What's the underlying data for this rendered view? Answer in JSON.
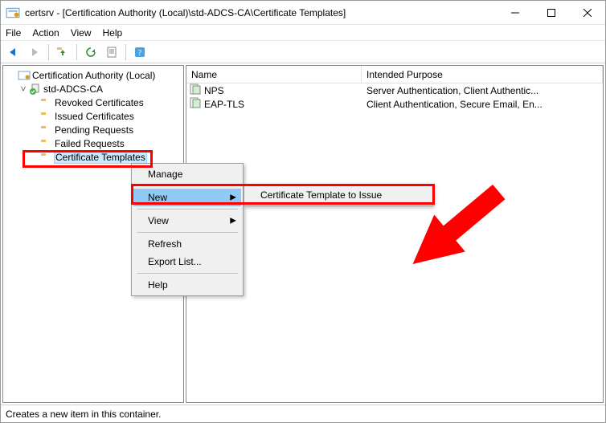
{
  "window": {
    "title": "certsrv - [Certification Authority (Local)\\std-ADCS-CA\\Certificate Templates]"
  },
  "menubar": [
    "File",
    "Action",
    "View",
    "Help"
  ],
  "tree": {
    "root": "Certification Authority (Local)",
    "ca": "std-ADCS-CA",
    "nodes": [
      "Revoked Certificates",
      "Issued Certificates",
      "Pending Requests",
      "Failed Requests",
      "Certificate Templates"
    ]
  },
  "list": {
    "columns": {
      "name": "Name",
      "purpose": "Intended Purpose"
    },
    "rows": [
      {
        "name": "NPS",
        "purpose": "Server Authentication, Client Authentic..."
      },
      {
        "name": "EAP-TLS",
        "purpose": "Client Authentication, Secure Email, En..."
      }
    ]
  },
  "context_menu": {
    "items": [
      "Manage",
      "New",
      "View",
      "Refresh",
      "Export List...",
      "Help"
    ],
    "submenu": {
      "parent": "New",
      "items": [
        "Certificate Template to Issue"
      ]
    }
  },
  "statusbar": "Creates a new item in this container."
}
